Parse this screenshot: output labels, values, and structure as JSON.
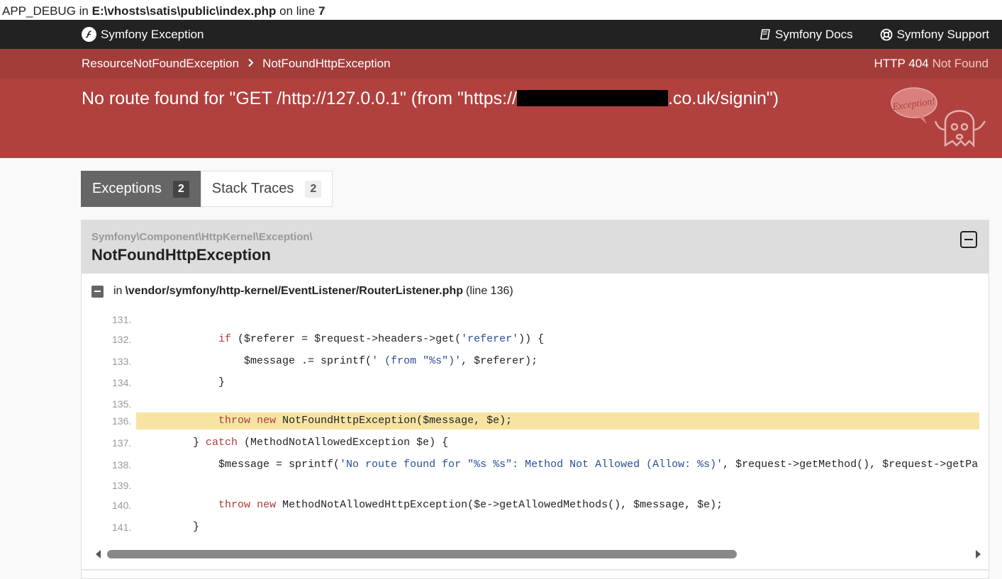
{
  "debug": {
    "prefix": "APP_DEBUG in",
    "path": "E:\\vhosts\\satis\\public\\index.php",
    "on_line": "on line",
    "line": "7"
  },
  "topbar": {
    "brand": "Symfony Exception",
    "docs": "Symfony Docs",
    "support": "Symfony Support"
  },
  "breadcrumb": {
    "items": [
      "ResourceNotFoundException",
      "NotFoundHttpException"
    ]
  },
  "status": {
    "code": "HTTP 404",
    "text": "Not Found"
  },
  "exception": {
    "message_start": "No route found for \"GET /http://127.0.0.1\" (from \"https://",
    "message_end": ".co.uk/signin\")",
    "ghost_label": "Exception!"
  },
  "tabs": [
    {
      "label": "Exceptions",
      "count": "2"
    },
    {
      "label": "Stack Traces",
      "count": "2"
    }
  ],
  "panel": {
    "namespace": "Symfony\\Component\\HttpKernel\\Exception\\",
    "class": "NotFoundHttpException",
    "in": "in",
    "file": "\\vendor/symfony/http-kernel/EventListener/RouterListener.php",
    "line": "(line 136)"
  },
  "code": {
    "line_numbers": [
      "131.",
      "132.",
      "133.",
      "134.",
      "135.",
      "136.",
      "137.",
      "138.",
      "139.",
      "140.",
      "141."
    ],
    "lines": [
      "",
      "            if ($referer = $request->headers->get('referer')) {",
      "                $message .= sprintf(' (from \"%s\")', $referer);",
      "            }",
      "",
      "            throw new NotFoundHttpException($message, $e);",
      "        } catch (MethodNotAllowedException $e) {",
      "            $message = sprintf('No route found for \"%s %s\": Method Not Allowed (Allow: %s)', $request->getMethod(), $request->getPat",
      "",
      "            throw new MethodNotAllowedHttpException($e->getAllowedMethods(), $message, $e);",
      "        }"
    ],
    "highlight_line": "136."
  }
}
